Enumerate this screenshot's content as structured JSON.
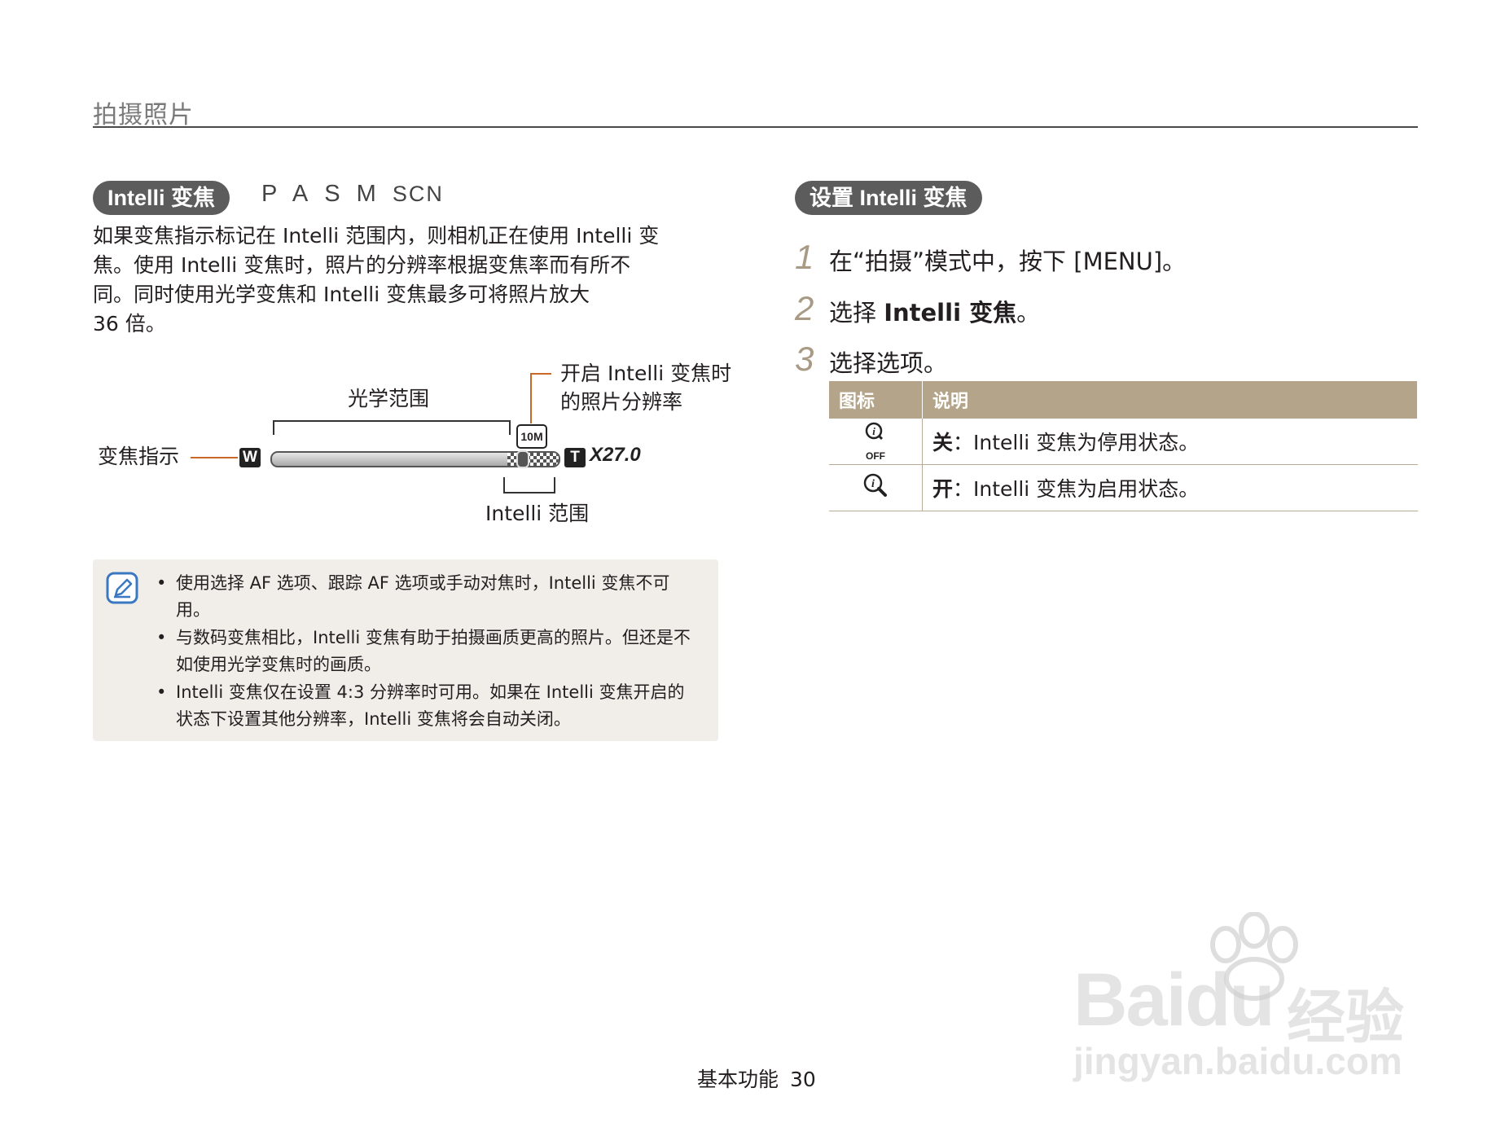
{
  "header": {
    "section_title": "拍摄照片"
  },
  "left": {
    "pill_label": "Intelli 变焦",
    "modes": [
      "P",
      "A",
      "S",
      "M",
      "SCN"
    ],
    "paragraph_lines": [
      "如果变焦指示标记在 Intelli 范围内，则相机正在使用 Intelli 变",
      "焦。使用 Intelli 变焦时，照片的分辨率根据变焦率而有所不",
      "同。同时使用光学变焦和 Intelli 变焦最多可将照片放大",
      "36 倍。"
    ],
    "diagram": {
      "optical_range_label": "光学范围",
      "resolution_label_line1": "开启 Intelli 变焦时",
      "resolution_label_line2": "的照片分辨率",
      "zoom_indicator_label": "变焦指示",
      "intelli_range_label": "Intelli 范围",
      "wide_icon": "W",
      "tele_icon": "T",
      "resolution_badge": "10M",
      "zoom_value": "X27.0"
    },
    "notes": [
      "使用选择 AF 选项、跟踪 AF 选项或手动对焦时，Intelli 变焦不可用。",
      "与数码变焦相比，Intelli 变焦有助于拍摄画质更高的照片。但还是不如使用光学变焦时的画质。",
      "Intelli 变焦仅在设置 4:3 分辨率时可用。如果在 Intelli 变焦开启的状态下设置其他分辨率，Intelli 变焦将会自动关闭。"
    ]
  },
  "right": {
    "pill_label": "设置 Intelli 变焦",
    "steps": [
      {
        "num": "1",
        "text": "在“拍摄”模式中，按下 [MENU]。"
      },
      {
        "num": "2",
        "text_prefix": "选择 ",
        "text_bold": "Intelli 变焦",
        "text_suffix": "。"
      },
      {
        "num": "3",
        "text": "选择选项。"
      }
    ],
    "table": {
      "headers": [
        "图标",
        "说明"
      ],
      "rows": [
        {
          "icon": "intelli-off-icon",
          "icon_label": "OFF",
          "bold": "关",
          "text": "：Intelli 变焦为停用状态。"
        },
        {
          "icon": "intelli-on-icon",
          "bold": "开",
          "text": "：Intelli 变焦为启用状态。"
        }
      ]
    }
  },
  "footer": {
    "label": "基本功能",
    "page": "30"
  },
  "watermark": {
    "brand": "Bai",
    "brand2": "du",
    "cn": "经验",
    "url": "jingyan.baidu.com"
  },
  "colors": {
    "accent_tan": "#b4a48a",
    "pill_gray": "#5c5c5c",
    "orange_leader": "#c8692a",
    "note_bg": "#f1ede8",
    "icon_blue": "#3a78c2"
  }
}
